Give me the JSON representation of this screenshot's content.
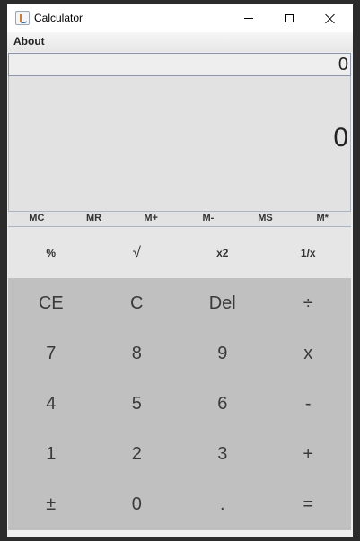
{
  "window": {
    "title": "Calculator",
    "icon": "java-cup-icon"
  },
  "menu": {
    "items": [
      "About"
    ]
  },
  "display": {
    "expression": "0",
    "result": "0"
  },
  "memory_buttons": [
    "MC",
    "MR",
    "M+",
    "M-",
    "MS",
    "M*"
  ],
  "function_buttons": [
    "%",
    "√",
    "x2",
    "1/x"
  ],
  "keypad": [
    [
      "CE",
      "C",
      "Del",
      "÷"
    ],
    [
      "7",
      "8",
      "9",
      "x"
    ],
    [
      "4",
      "5",
      "6",
      "-"
    ],
    [
      "1",
      "2",
      "3",
      "+"
    ],
    [
      "±",
      "0",
      ".",
      "="
    ]
  ],
  "colors": {
    "keypad_background": "#c0c0c0",
    "display_background": "#e2e2e2",
    "window_background": "#eeeeee",
    "outer_background": "#2b2b2b"
  }
}
